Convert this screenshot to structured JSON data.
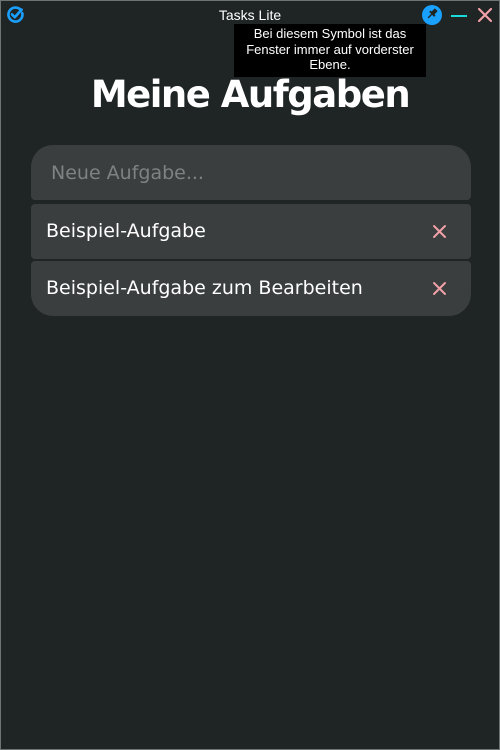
{
  "window": {
    "title": "Tasks Lite",
    "app_icon": "check-circle-icon",
    "controls": {
      "pin_icon": "pin-icon",
      "minimize_icon": "minimize-icon",
      "close_icon": "close-icon"
    },
    "tooltip": {
      "lines": [
        "Bei diesem Symbol ist das",
        "Fenster immer auf vorderster",
        "Ebene."
      ]
    }
  },
  "main": {
    "heading": "Meine Aufgaben",
    "new_task": {
      "placeholder": "Neue Aufgabe...",
      "value": ""
    },
    "tasks": [
      {
        "label": "Beispiel-Aufgabe",
        "delete_icon": "delete-x-icon"
      },
      {
        "label": "Beispiel-Aufgabe zum Bearbeiten",
        "delete_icon": "delete-x-icon"
      }
    ]
  },
  "colors": {
    "background": "#1f2424",
    "card": "#3a3e3e",
    "accent_blue": "#1aa0ff",
    "minimize_cyan": "#19d9d9",
    "close_pink": "#f2a0a8",
    "delete_pink": "#f2a0a8",
    "text": "#ffffff",
    "placeholder": "#7e8282"
  }
}
